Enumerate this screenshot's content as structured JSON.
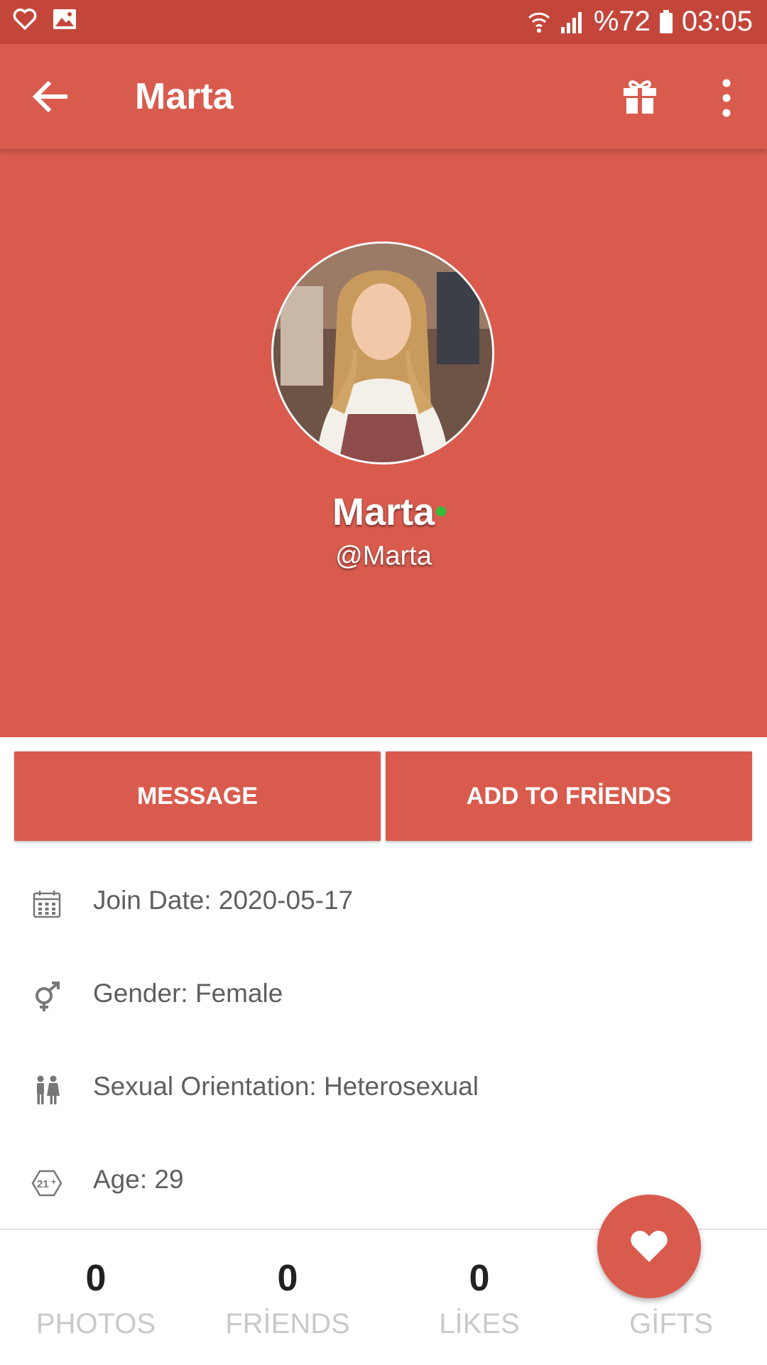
{
  "status_bar": {
    "battery_text": "%72",
    "time": "03:05",
    "icons": [
      "heart-outline-icon",
      "image-icon",
      "wifi-icon",
      "signal-icon",
      "battery-icon"
    ]
  },
  "app_bar": {
    "title": "Marta",
    "icons": [
      "back-arrow-icon",
      "gift-icon",
      "more-vertical-icon"
    ]
  },
  "profile": {
    "name": "Marta",
    "username": "@Marta",
    "online": true
  },
  "actions": {
    "message_label": "MESSAGE",
    "add_friend_label": "ADD TO FRİENDS"
  },
  "info": [
    {
      "icon": "calendar-icon",
      "text": "Join Date: 2020-05-17"
    },
    {
      "icon": "gender-icon",
      "text": "Gender: Female"
    },
    {
      "icon": "couple-icon",
      "text": "Sexual Orientation: Heterosexual"
    },
    {
      "icon": "age-21-icon",
      "text": "Age: 29"
    }
  ],
  "stats": [
    {
      "count": "0",
      "label": "PHOTOS"
    },
    {
      "count": "0",
      "label": "FRİENDS"
    },
    {
      "count": "0",
      "label": "LİKES"
    },
    {
      "count": "",
      "label": "GİFTS"
    }
  ],
  "colors": {
    "primary": "#d95b4e",
    "status_bar": "#c4463b",
    "online": "#2fbf3a",
    "info_text": "#5f5f5f",
    "stat_label": "#c9c9c9"
  }
}
